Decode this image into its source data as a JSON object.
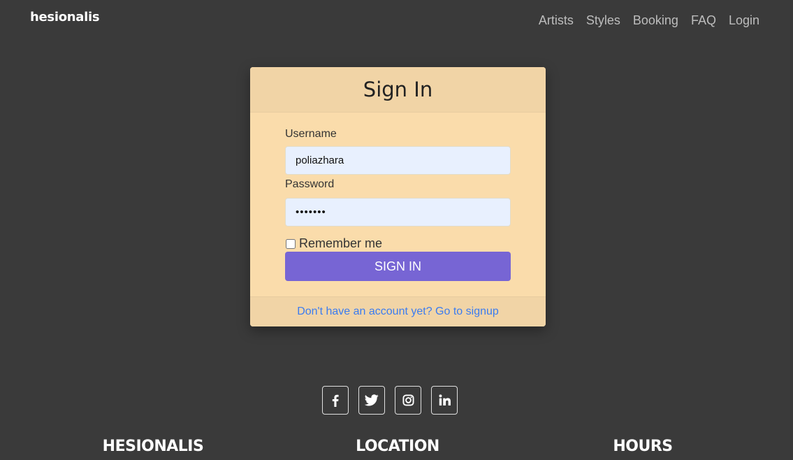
{
  "navbar": {
    "brand": "hesionalis",
    "links": [
      "Artists",
      "Styles",
      "Booking",
      "FAQ",
      "Login"
    ]
  },
  "signin": {
    "title": "Sign In",
    "username_label": "Username",
    "username_value": "poliazhara",
    "password_label": "Password",
    "password_value": "•••••••",
    "remember_label": "Remember me",
    "remember_checked": false,
    "button_label": "SIGN IN",
    "signup_link": "Don't have an account yet? Go to signup"
  },
  "social": [
    {
      "name": "facebook-icon"
    },
    {
      "name": "twitter-icon"
    },
    {
      "name": "instagram-icon"
    },
    {
      "name": "linkedin-icon"
    }
  ],
  "footer": {
    "headings": [
      "HESIONALIS",
      "LOCATION",
      "HOURS"
    ]
  },
  "colors": {
    "background": "#3a3a3a",
    "card": "#fadcab",
    "card_header": "#f1d4a6",
    "button": "#7765d4",
    "link": "#3b7cf0",
    "input": "#e8f0fe"
  }
}
